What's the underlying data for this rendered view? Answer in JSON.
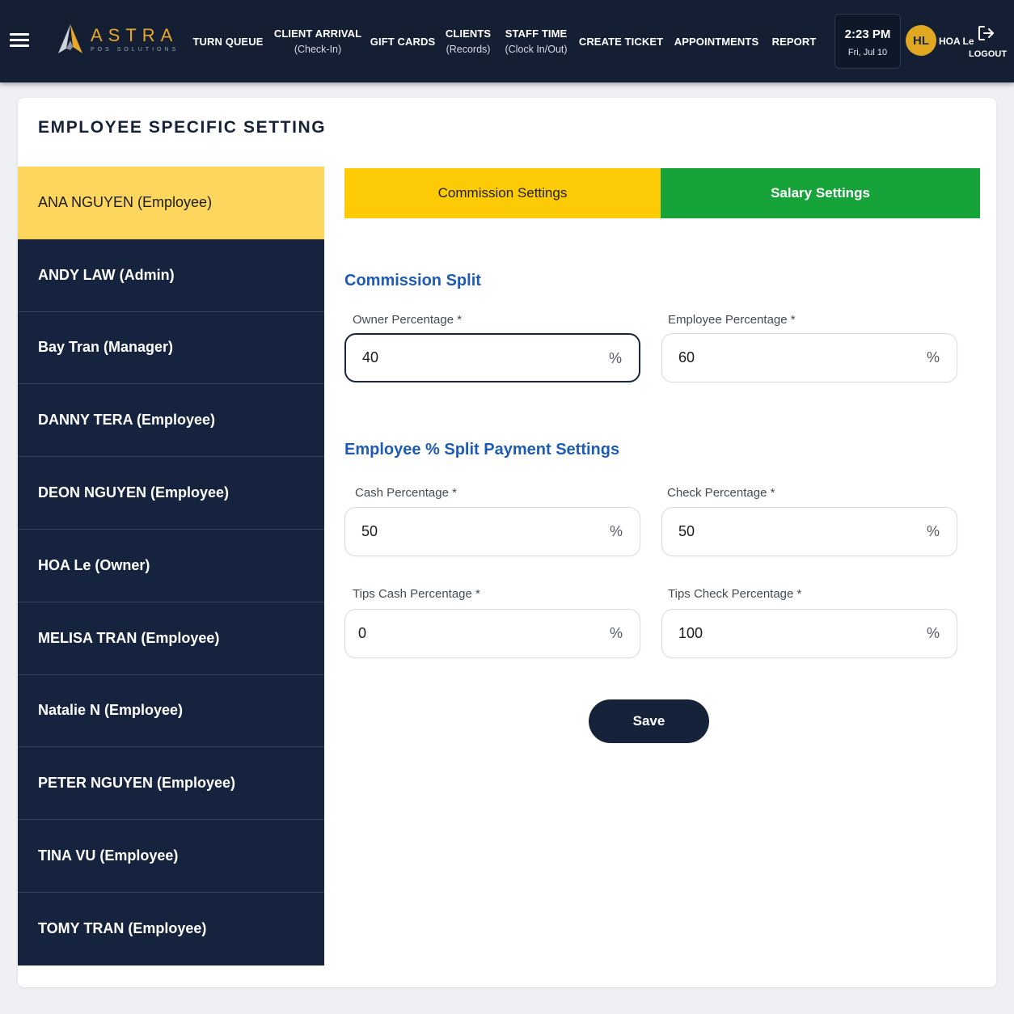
{
  "header": {
    "logo": {
      "word": "ASTRA",
      "sub": "POS SOLUTIONS"
    },
    "nav": [
      {
        "line1": "TURN QUEUE",
        "line2": ""
      },
      {
        "line1": "CLIENT ARRIVAL",
        "line2": "(Check-In)"
      },
      {
        "line1": "GIFT CARDS",
        "line2": ""
      },
      {
        "line1": "CLIENTS",
        "line2": "(Records)"
      },
      {
        "line1": "STAFF TIME",
        "line2": "(Clock In/Out)"
      },
      {
        "line1": "CREATE TICKET",
        "line2": ""
      },
      {
        "line1": "APPOINTMENTS",
        "line2": ""
      },
      {
        "line1": "REPORT",
        "line2": ""
      }
    ],
    "clock": {
      "time": "2:23 PM",
      "date": "Fri, Jul 10"
    },
    "user": {
      "initials": "HL",
      "name": "HOA Le"
    },
    "logout_label": "LOGOUT"
  },
  "page": {
    "title": "EMPLOYEE SPECIFIC SETTING",
    "employees": [
      {
        "label": "ANA NGUYEN (Employee)",
        "active": true
      },
      {
        "label": "ANDY LAW (Admin)"
      },
      {
        "label": "Bay Tran (Manager)"
      },
      {
        "label": "DANNY TERA (Employee)"
      },
      {
        "label": "DEON NGUYEN (Employee)"
      },
      {
        "label": "HOA Le (Owner)"
      },
      {
        "label": "MELISA TRAN (Employee)"
      },
      {
        "label": "Natalie N (Employee)"
      },
      {
        "label": "PETER NGUYEN (Employee)"
      },
      {
        "label": "TINA VU (Employee)"
      },
      {
        "label": "TOMY TRAN (Employee)"
      }
    ],
    "tabs": {
      "commission": "Commission Settings",
      "salary": "Salary Settings"
    },
    "commission_split": {
      "title": "Commission Split",
      "owner_label": "Owner Percentage *",
      "owner_value": "40",
      "employee_label": "Employee Percentage *",
      "employee_value": "60"
    },
    "payment_split": {
      "title": "Employee % Split Payment Settings",
      "cash_label": "Cash Percentage *",
      "cash_value": "50",
      "check_label": "Check Percentage *",
      "check_value": "50",
      "tips_cash_label": "Tips Cash Percentage *",
      "tips_cash_value": "0",
      "tips_check_label": "Tips Check Percentage *",
      "tips_check_value": "100"
    },
    "unit": "%",
    "save_label": "Save"
  },
  "colors": {
    "header_bg": "#141f33",
    "brand_gold": "#e8a62a",
    "active_employee": "#fdd65e",
    "commission_tab": "#fccb05",
    "salary_tab": "#16a33a",
    "section_title": "#1e5bb5",
    "navy": "#16223a"
  }
}
